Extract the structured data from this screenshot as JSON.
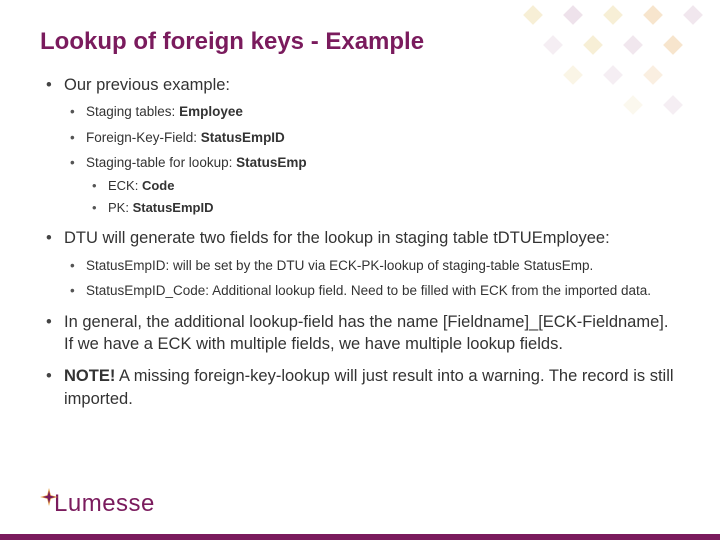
{
  "colors": {
    "accent": "#7a1b5d",
    "gold": "#e0c060",
    "orange": "#e39a3c"
  },
  "title": "Lookup of foreign keys - Example",
  "bullets": {
    "b1": {
      "text": "Our previous example:"
    },
    "b1_1": {
      "label": "Staging tables: ",
      "value": "Employee"
    },
    "b1_2": {
      "label": "Foreign-Key-Field: ",
      "value": "StatusEmpID"
    },
    "b1_3": {
      "label": "Staging-table for lookup: ",
      "value": "StatusEmp"
    },
    "b1_3_1": {
      "label": "ECK: ",
      "value": "Code"
    },
    "b1_3_2": {
      "label": "PK: ",
      "value": "StatusEmpID"
    },
    "b2": {
      "text": "DTU will generate two fields for the lookup in staging table tDTUEmployee:"
    },
    "b2_1": {
      "text": "StatusEmpID: will be set by the DTU via ECK-PK-lookup of staging-table StatusEmp."
    },
    "b2_2": {
      "text": "StatusEmpID_Code: Additional lookup field. Need to be filled with ECK from the imported data."
    },
    "b3": {
      "text": "In general, the additional lookup-field has the name [Fieldname]_[ECK-Fieldname]. If we have a ECK with multiple fields, we have multiple lookup fields."
    },
    "b4": {
      "note": "NOTE!",
      "text": " A missing foreign-key-lookup will just result into a warning. The record is still imported."
    }
  },
  "logo": {
    "text": "Lumesse"
  }
}
